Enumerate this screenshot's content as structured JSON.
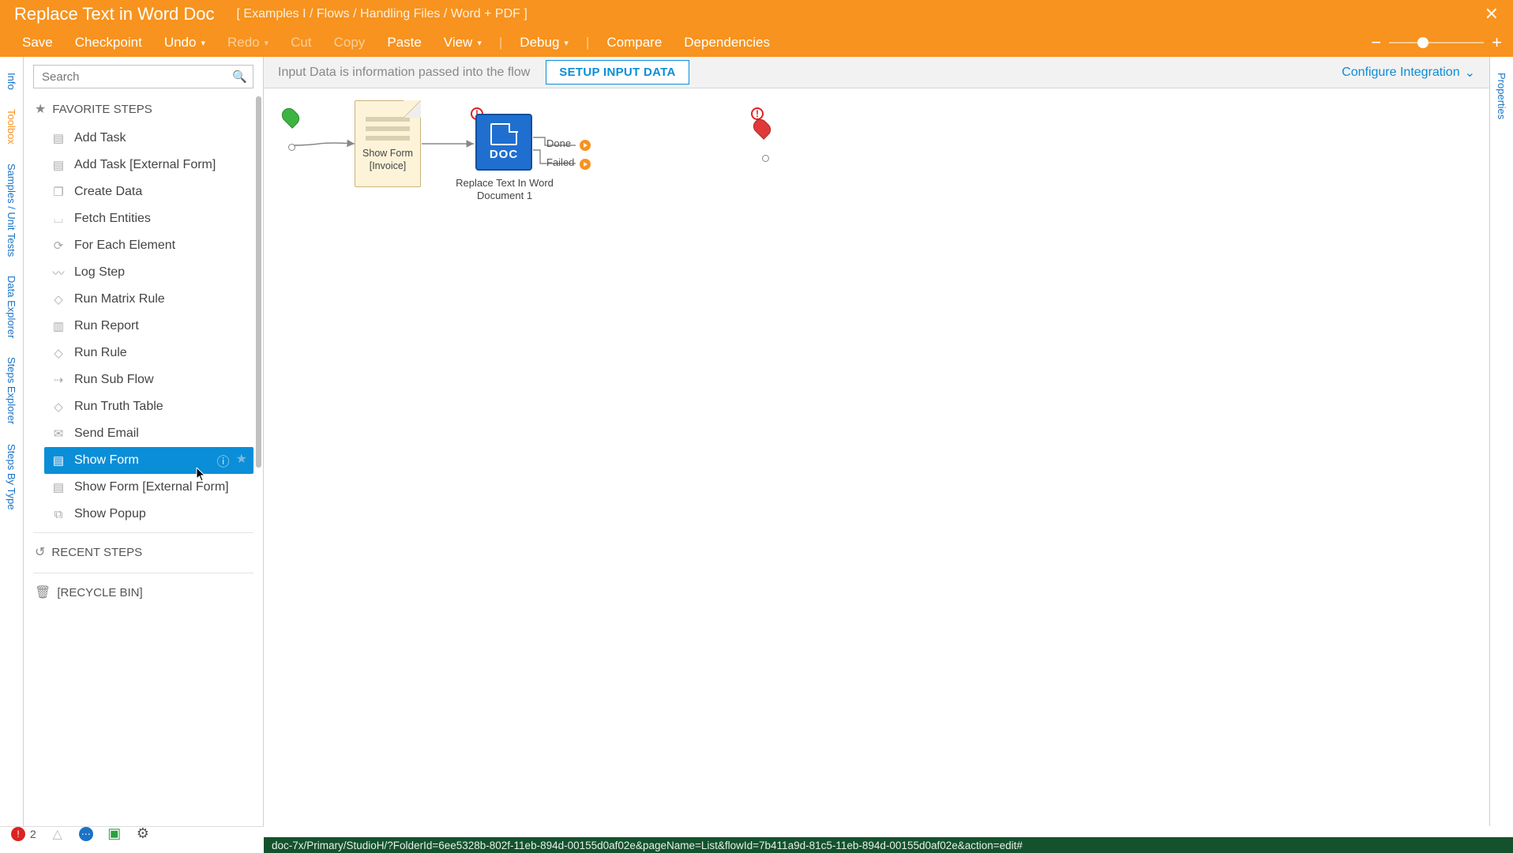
{
  "titlebar": {
    "title": "Replace Text in Word Doc",
    "breadcrumb": "[ Examples I / Flows / Handling Files / Word + PDF ]"
  },
  "menubar": {
    "save": "Save",
    "checkpoint": "Checkpoint",
    "undo": "Undo",
    "redo": "Redo",
    "cut": "Cut",
    "copy": "Copy",
    "paste": "Paste",
    "view": "View",
    "debug": "Debug",
    "compare": "Compare",
    "dependencies": "Dependencies"
  },
  "lefttabs": [
    "Info",
    "Toolbox",
    "Samples / Unit Tests",
    "Data Explorer",
    "Steps Explorer",
    "Steps By Type"
  ],
  "lefttabs_active_index": 1,
  "righttabs": [
    "Properties"
  ],
  "toolbox": {
    "search_placeholder": "Search",
    "sections": {
      "favorite": "FAVORITE STEPS",
      "recent": "RECENT STEPS",
      "recycle": "[RECYCLE BIN]"
    },
    "favorite_steps": [
      "Add Task",
      "Add Task [External Form]",
      "Create Data",
      "Fetch Entities",
      "For Each Element",
      "Log Step",
      "Run Matrix Rule",
      "Run Report",
      "Run Rule",
      "Run Sub Flow",
      "Run Truth Table",
      "Send Email",
      "Show Form",
      "Show Form [External Form]",
      "Show Popup"
    ],
    "selected_step_index": 12
  },
  "infobar": {
    "text": "Input Data is information passed into the flow",
    "setup_button": "SETUP INPUT DATA",
    "configure": "Configure Integration"
  },
  "flow": {
    "form_node_line1": "Show Form",
    "form_node_line2": "[Invoice]",
    "doc_node_text": "DOC",
    "doc_node_label": "Replace Text In Word Document 1",
    "port_done": "Done",
    "port_failed": "Failed"
  },
  "status": {
    "error_count": "2",
    "url": "doc-7x/Primary/StudioH/?FolderId=6ee5328b-802f-11eb-894d-00155d0af02e&pageName=List&flowId=7b411a9d-81c5-11eb-894d-00155d0af02e&action=edit#"
  }
}
